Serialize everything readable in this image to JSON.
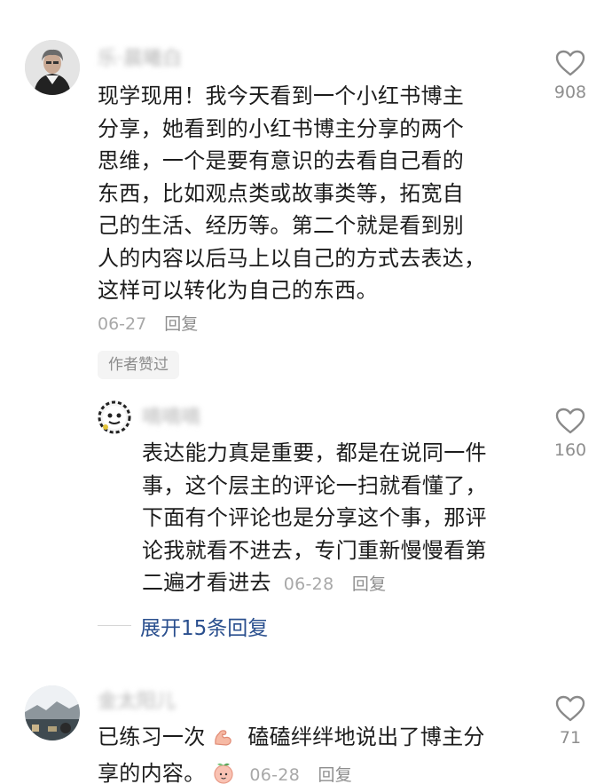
{
  "comments": [
    {
      "username": "乐·晨曦白",
      "text": "现学现用！我今天看到一个小红书博主分享，她看到的小红书博主分享的两个思维，一个是要有意识的去看自己看的东西，比如观点类或故事类等，拓宽自己的生活、经历等。第二个就是看到别人的内容以后马上以自己的方式去表达，这样可以转化为自己的东西。",
      "lines": [
        "现学现用！我今天看到一个小红书博主",
        "分享，她看到的小红书博主分享的两个",
        "思维，一个是要有意识的去看自己看的",
        "东西，比如观点类或故事类等，拓宽自",
        "己的生活、经历等。第二个就是看到别",
        "人的内容以后马上以自己的方式去表达，",
        "这样可以转化为自己的东西。"
      ],
      "date": "06-27",
      "reply_label": "回复",
      "likes": "908",
      "badge": "作者赞过"
    },
    {
      "username": "嘀嘀嘀",
      "lines": [
        "表达能力真是重要，都是在说同一件",
        "事，这个层主的评论一扫就看懂了，",
        "下面有个评论也是分享这个事，那评",
        "论我就看不进去，专门重新慢慢看第",
        "二遍才看进去"
      ],
      "date": "06-28",
      "reply_label": "回复",
      "likes": "160"
    },
    {
      "username": "金太阳儿",
      "line1_a": "已练习一次",
      "line1_b": "磕磕绊绊地说出了博主分",
      "line2": "享的内容。",
      "date": "06-28",
      "reply_label": "回复",
      "likes": "71"
    }
  ],
  "expand_replies": "展开15条回复",
  "icons": {
    "like": "heart-outline-icon",
    "flex": "flexed-biceps-icon",
    "peach": "peach-face-icon"
  },
  "colors": {
    "link": "#2a4f8e",
    "meta": "#a8a8a8"
  }
}
